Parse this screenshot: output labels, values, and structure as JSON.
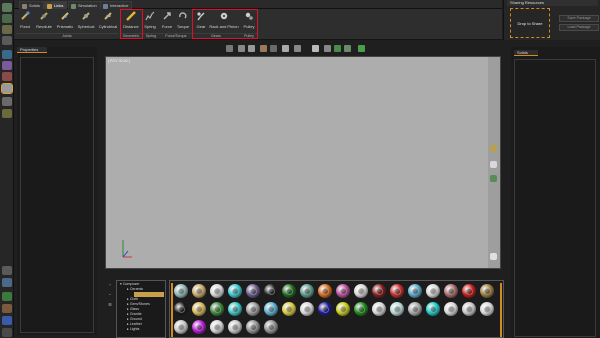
{
  "tabs": [
    {
      "label": "Solids",
      "active": false,
      "icon": "solids-icon",
      "color": "#8a7f70"
    },
    {
      "label": "Links",
      "active": true,
      "icon": "links-icon",
      "color": "#c7a14a"
    },
    {
      "label": "Simulation",
      "active": false,
      "icon": "simulation-icon",
      "color": "#6a8c6a"
    },
    {
      "label": "Interactive",
      "active": false,
      "icon": "interactive-icon",
      "color": "#6a7d9c"
    }
  ],
  "ribbon": {
    "buttons": [
      {
        "label": "Fixed",
        "icon": "fixed-icon",
        "color": "#c8b060"
      },
      {
        "label": "Revolute",
        "icon": "revolute-icon",
        "color": "#c8b060"
      },
      {
        "label": "Prismatic",
        "icon": "prismatic-icon",
        "color": "#d6c070"
      },
      {
        "label": "Spherical",
        "icon": "spherical-icon",
        "color": "#c8b060"
      },
      {
        "label": "Cylindrical",
        "icon": "cylindrical-icon",
        "color": "#d0b468"
      },
      {
        "label": "Distance",
        "icon": "distance-icon",
        "color": "#e2b43a"
      },
      {
        "label": "Spring",
        "icon": "spring-icon",
        "color": "#b0b0b0"
      },
      {
        "label": "Force",
        "icon": "force-icon",
        "color": "#b8b8b8"
      },
      {
        "label": "Torque",
        "icon": "torque-icon",
        "color": "#b8b8b8"
      },
      {
        "label": "Gear",
        "icon": "gear-icon",
        "color": "#cfcfcf"
      },
      {
        "label": "Rack and Pinion",
        "icon": "rack-and-pinion-icon",
        "color": "#cfcfcf"
      },
      {
        "label": "Pulley",
        "icon": "pulley-icon",
        "color": "#cfcfcf"
      }
    ],
    "groups": [
      "Joints",
      "Geometric",
      "Spring",
      "Force/Torque",
      "Gears",
      "Pulley"
    ],
    "highlight_color": "#e0102a"
  },
  "sharing": {
    "title": "Sharing Resources",
    "drop_label": "Drop to Share",
    "save_package": "Save Package",
    "load_package": "Load Package"
  },
  "properties": {
    "tab": "Properties"
  },
  "viewport": {
    "pov_label": "[ POV 30.00 ]"
  },
  "right_panel": {
    "tab": "Solids"
  },
  "library": {
    "tools": [
      "+",
      "−",
      "☰"
    ],
    "tree": [
      {
        "label": "Composer",
        "level": 0,
        "selected": false
      },
      {
        "label": "Ceramic",
        "level": 1,
        "selected": false
      },
      {
        "label": "",
        "level": 1,
        "selected": true
      },
      {
        "label": "Cloth",
        "level": 1,
        "selected": false
      },
      {
        "label": "Gem/Stones",
        "level": 1,
        "selected": false
      },
      {
        "label": "Glass",
        "level": 1,
        "selected": false
      },
      {
        "label": "Granite",
        "level": 1,
        "selected": false
      },
      {
        "label": "Ground",
        "level": 1,
        "selected": false
      },
      {
        "label": "Leather",
        "level": 1,
        "selected": false
      },
      {
        "label": "Lights",
        "level": 1,
        "selected": false
      }
    ],
    "swatch_colors": [
      "#8fb8b8",
      "#c8a868",
      "#d8d8d8",
      "#38c8d0",
      "#6a5a8a",
      "#202020",
      "#1a6a1a",
      "#5a9a8a",
      "#d86a1a",
      "#b84a9a",
      "#d8d8d8",
      "#8a1a1a",
      "#c82a2a",
      "#58a8c8",
      "#d8d8d8",
      "#a86a6a",
      "#c81a1a",
      "#9a7a3a",
      "#1a1a1a",
      "#d8b858",
      "#3a8a3a",
      "#38c8c8",
      "#9a9a9a",
      "#58b0d0",
      "#d8c838",
      "#d8d8d8",
      "#1a1a9a",
      "#c8c818",
      "#1a8a1a",
      "#d8d8d8",
      "#b8d8d8",
      "#a8a8a8",
      "#1ac8c8",
      "#d8d8d8",
      "#c8c8c8",
      "#d8d8d8",
      "#c8c8c8",
      "#b818d8",
      "#d8d8d8",
      "#c8c8c8",
      "#909090",
      "#909090"
    ]
  }
}
